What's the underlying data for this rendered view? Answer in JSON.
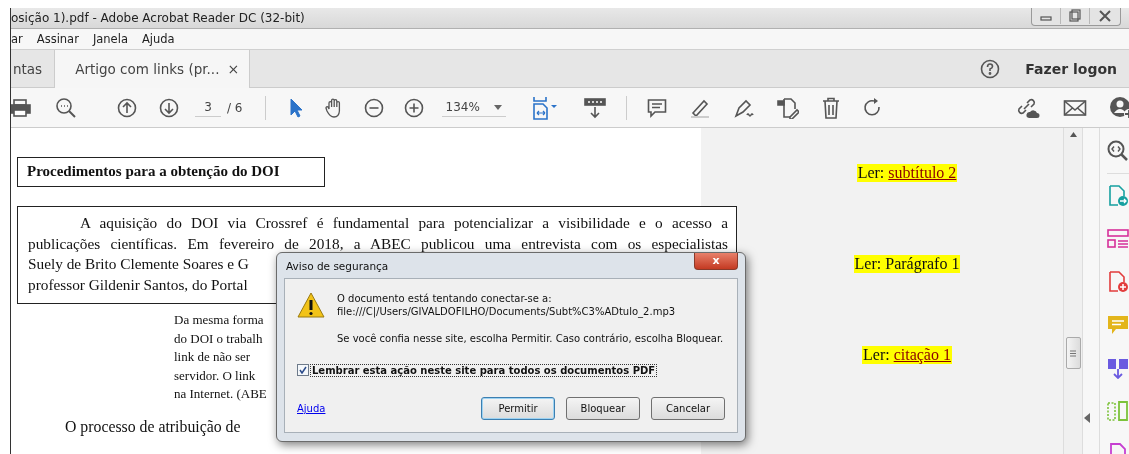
{
  "window": {
    "title": "osição 1).pdf - Adobe Acrobat Reader DC (32-bit)"
  },
  "menu": [
    "ar",
    "Assinar",
    "Janela",
    "Ajuda"
  ],
  "tabs": [
    {
      "label": "ntas",
      "selected": false,
      "closable": false
    },
    {
      "label": "Artigo com links (pr...",
      "selected": true,
      "closable": true,
      "close": "×"
    }
  ],
  "account": {
    "label": "Fazer logon"
  },
  "toolbar": {
    "page": "3",
    "page_total": "/ 6",
    "zoom": "134%"
  },
  "document": {
    "heading": "Procedimentos para a obtenção do DOI",
    "paragraph": [
      {
        "kind": "full",
        "text": "A aquisição do DOI via Crossref é fundamental para potencializar a visibilidade e o acesso a"
      },
      {
        "kind": "full",
        "text": "publicações científicas. Em fevereiro de 2018, a ABEC publicou uma entrevista com os especialistas"
      },
      {
        "kind": "cut",
        "text": "Suely de Brito Clemente Soares e G"
      },
      {
        "kind": "cut",
        "text": "professor Gildenir Santos, do Portal"
      }
    ],
    "quote": [
      "Da mesma forma",
      "do DOI o trabalh",
      "link de não ser",
      "servidor. O link",
      "na Internet. (ABE"
    ],
    "next_line": "O processo de atribuição de"
  },
  "links": [
    {
      "kind": "link",
      "label": "Ler:",
      "link": "subtítulo 2"
    },
    {
      "kind": "plain",
      "label": "Ler: Parágrafo 1"
    },
    {
      "kind": "link",
      "label": "Ler:",
      "link": "citação 1"
    }
  ],
  "dialog": {
    "title": "Aviso de segurança",
    "close": "x",
    "message": [
      "O documento está tentando conectar-se a:",
      "file:///C|/Users/GIVALDOFILHO/Documents/Subt%C3%ADtulo_2.mp3"
    ],
    "advice": "Se você confia nesse site, escolha Permitir. Caso contrário, escolha Bloquear.",
    "remember": {
      "label": "Lembrar esta ação neste site para todos os documentos PDF",
      "checked": true
    },
    "help": "Ajuda",
    "buttons": [
      {
        "label": "Permitir",
        "default": true
      },
      {
        "label": "Bloquear",
        "default": false
      },
      {
        "label": "Cancelar",
        "default": false
      }
    ]
  }
}
